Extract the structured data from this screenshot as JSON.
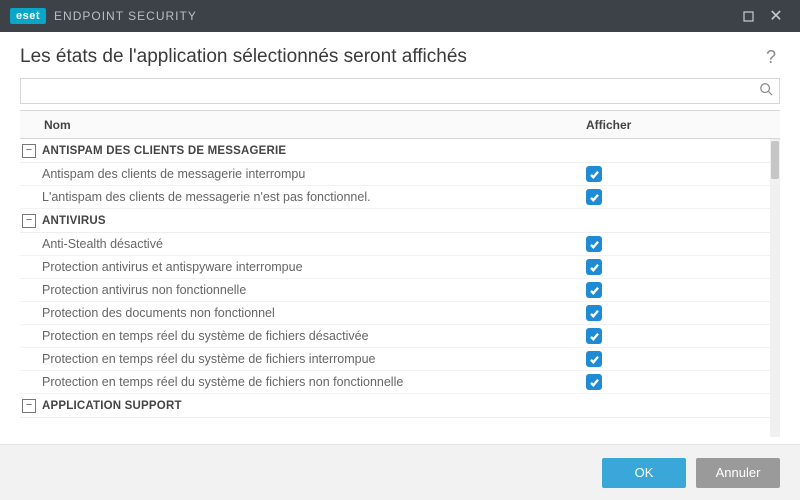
{
  "window": {
    "brand_badge": "eset",
    "brand_title": "ENDPOINT SECURITY"
  },
  "header": {
    "title": "Les états de l'application sélectionnés seront affichés",
    "help": "?"
  },
  "search": {
    "placeholder": ""
  },
  "columns": {
    "name": "Nom",
    "show": "Afficher"
  },
  "groups": [
    {
      "label": "ANTISPAM DES CLIENTS DE MESSAGERIE",
      "expanded": true,
      "items": [
        {
          "label": "Antispam des clients de messagerie interrompu",
          "checked": true
        },
        {
          "label": "L'antispam des clients de messagerie n'est pas fonctionnel.",
          "checked": true
        }
      ]
    },
    {
      "label": "ANTIVIRUS",
      "expanded": true,
      "items": [
        {
          "label": "Anti-Stealth désactivé",
          "checked": true
        },
        {
          "label": "Protection antivirus et antispyware interrompue",
          "checked": true
        },
        {
          "label": "Protection antivirus non fonctionnelle",
          "checked": true
        },
        {
          "label": "Protection des documents non fonctionnel",
          "checked": true
        },
        {
          "label": "Protection en temps réel du système de fichiers désactivée",
          "checked": true
        },
        {
          "label": "Protection en temps réel du système de fichiers interrompue",
          "checked": true
        },
        {
          "label": "Protection en temps réel du système de fichiers non fonctionnelle",
          "checked": true
        }
      ]
    },
    {
      "label": "APPLICATION SUPPORT",
      "expanded": true,
      "items": []
    }
  ],
  "footer": {
    "ok": "OK",
    "cancel": "Annuler"
  },
  "glyphs": {
    "minus": "−",
    "times": "✕"
  }
}
